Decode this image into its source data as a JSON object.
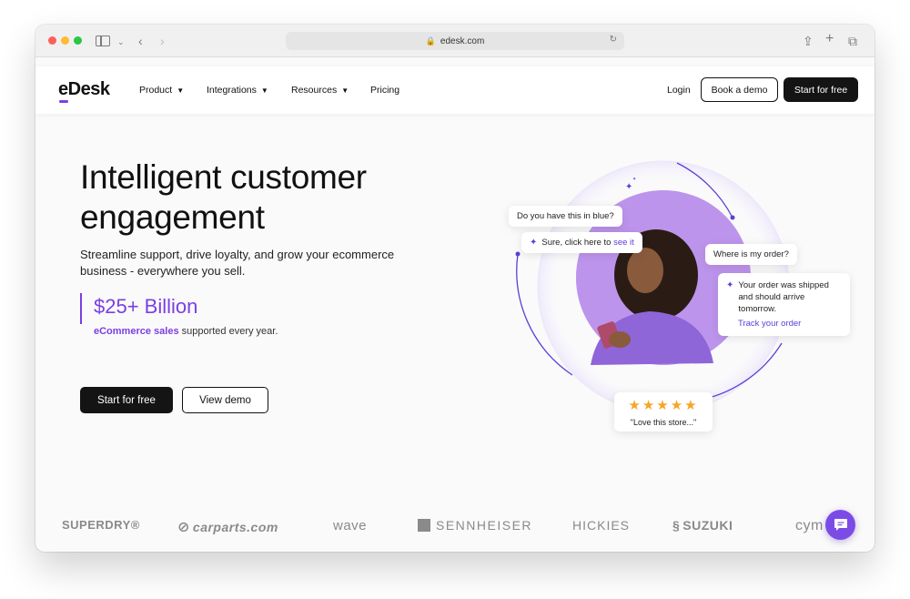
{
  "browser": {
    "url": "edesk.com"
  },
  "nav": {
    "logo": "eDesk",
    "items": [
      {
        "label": "Product",
        "has_menu": true
      },
      {
        "label": "Integrations",
        "has_menu": true
      },
      {
        "label": "Resources",
        "has_menu": true
      },
      {
        "label": "Pricing",
        "has_menu": false
      }
    ],
    "login": "Login",
    "book_demo": "Book a demo",
    "start_free": "Start for free"
  },
  "hero": {
    "title": "Intelligent customer engagement",
    "subtitle": "Streamline support, drive loyalty, and grow your ecommerce business - everywhere you sell.",
    "stat_value": "$25+ Billion",
    "stat_highlight": "eCommerce sales",
    "stat_rest": " supported every year.",
    "cta_primary": "Start for free",
    "cta_secondary": "View demo"
  },
  "illustration": {
    "bubble_question": "Do you have this in blue?",
    "bubble_answer_prefix": "Sure, click here to ",
    "bubble_answer_link": "see it",
    "bubble_order_q": "Where is my order?",
    "bubble_order_a": "Your order was shipped and should arrive tomorrow.",
    "bubble_track": "Track your order",
    "review_stars": "★★★★★",
    "review_text": "\"Love this store...\""
  },
  "logos": [
    "SUPERDRY®",
    "carparts.com",
    "wave",
    "SENNHEISER",
    "HICKIES",
    "SUZUKI",
    "cym"
  ],
  "colors": {
    "accent": "#7b3fe4",
    "dark": "#141414",
    "star": "#f5a623"
  }
}
